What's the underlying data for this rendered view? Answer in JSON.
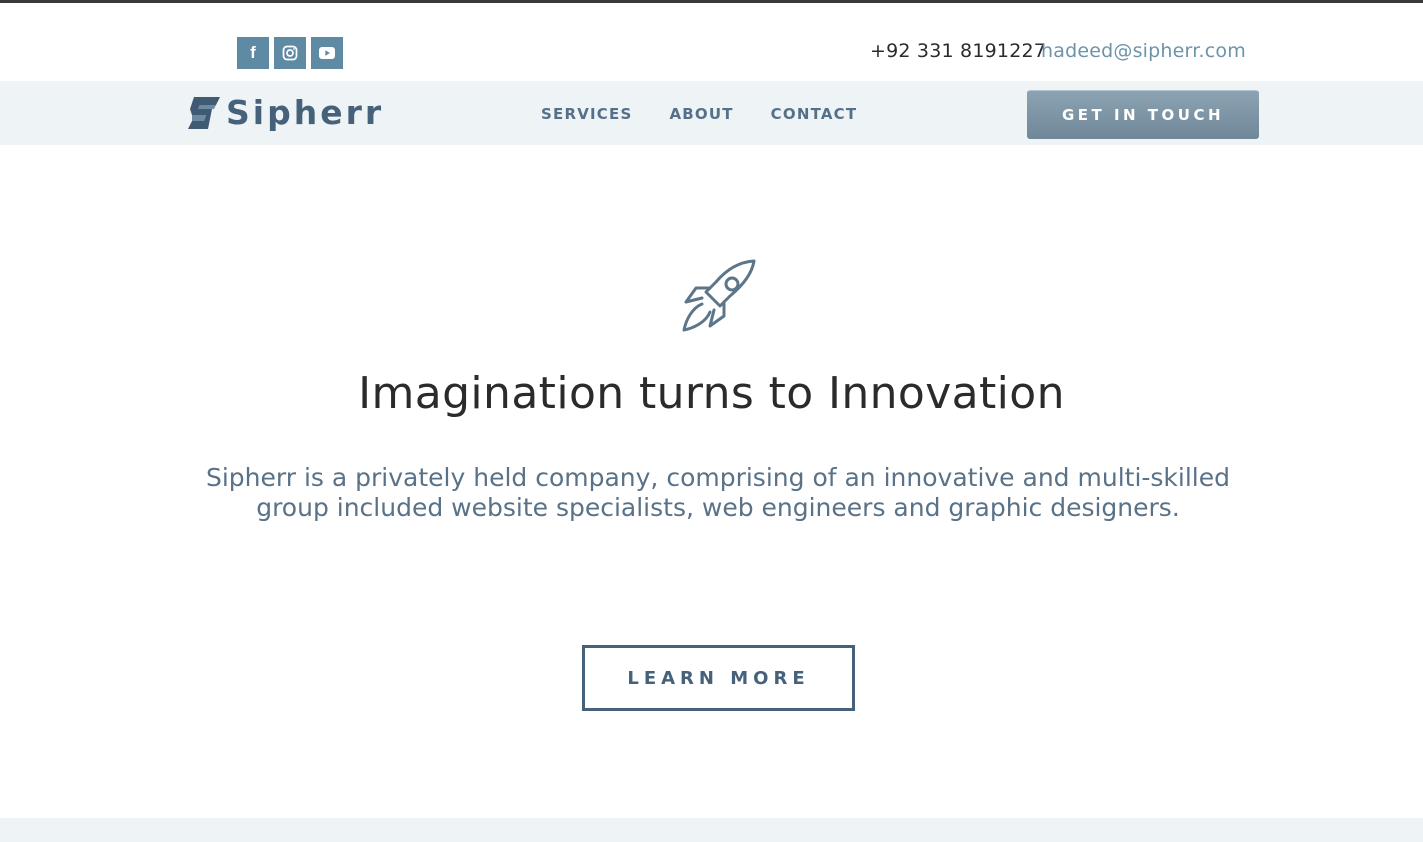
{
  "topbar": {
    "social": [
      {
        "icon": "facebook-icon",
        "glyph": "f"
      },
      {
        "icon": "instagram-icon"
      },
      {
        "icon": "youtube-icon"
      }
    ],
    "phone": "+92 331 8191227",
    "email": "hadeed@sipherr.com"
  },
  "nav": {
    "logo_text": "Sipherr",
    "links": [
      "SERVICES",
      "ABOUT",
      "CONTACT"
    ],
    "cta_label": "GET IN TOUCH"
  },
  "hero": {
    "icon": "rocket-icon",
    "headline": "Imagination turns to Innovation",
    "lead": "Sipherr is a privately held company, comprising of an innovative and multi-skilled group included website specialists, web engineers and graphic designers.",
    "button_label": "LEARN MORE"
  },
  "colors": {
    "accent": "#46627a",
    "social_bg": "#5f8aa3",
    "nav_bg": "#eef3f6",
    "email": "#6d93ab"
  }
}
